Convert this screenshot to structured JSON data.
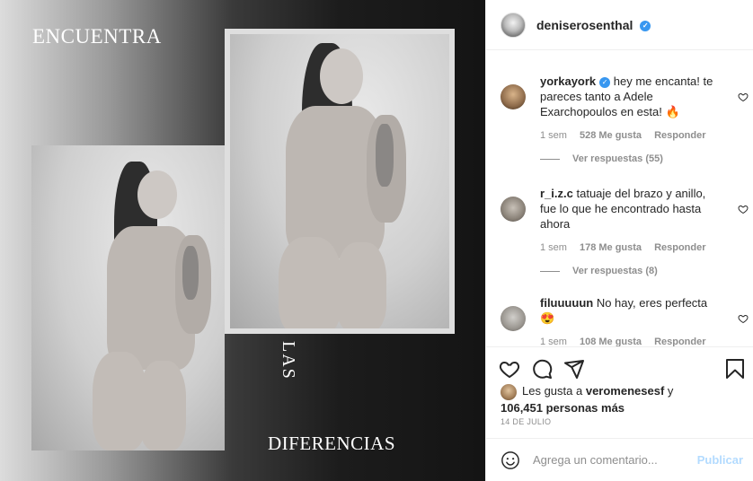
{
  "media": {
    "title_top": "ENCUENTRA",
    "title_las": "LAS",
    "title_bottom": "DIFERENCIAS"
  },
  "post": {
    "author": "deniserosenthal",
    "verified": true,
    "date": "14 DE JULIO"
  },
  "comments": [
    {
      "username": "yorkayork",
      "verified": true,
      "text": "hey me encanta! te pareces tanto a Adele Exarchopoulos en esta! 🔥",
      "age": "1 sem",
      "likes": "528 Me gusta",
      "reply_label": "Responder",
      "view_replies": "Ver respuestas (55)"
    },
    {
      "username": "r_i.z.c",
      "verified": false,
      "text": "tatuaje del brazo y anillo, fue lo que he encontrado hasta ahora",
      "age": "1 sem",
      "likes": "178 Me gusta",
      "reply_label": "Responder",
      "view_replies": "Ver respuestas (8)"
    },
    {
      "username": "filuuuuun",
      "verified": false,
      "text": "No hay, eres perfecta 😍",
      "age": "1 sem",
      "likes": "108 Me gusta",
      "reply_label": "Responder"
    }
  ],
  "likes_summary": {
    "prefix": "Les gusta a",
    "user": "veromenesesf",
    "conj": "y",
    "count": "106,451 personas más"
  },
  "composer": {
    "placeholder": "Agrega un comentario...",
    "publish_label": "Publicar"
  },
  "icons": {
    "like": "heart-icon",
    "comment": "comment-icon",
    "share": "share-icon",
    "save": "bookmark-icon",
    "emoji": "emoji-icon",
    "verified": "verified-badge-icon"
  }
}
